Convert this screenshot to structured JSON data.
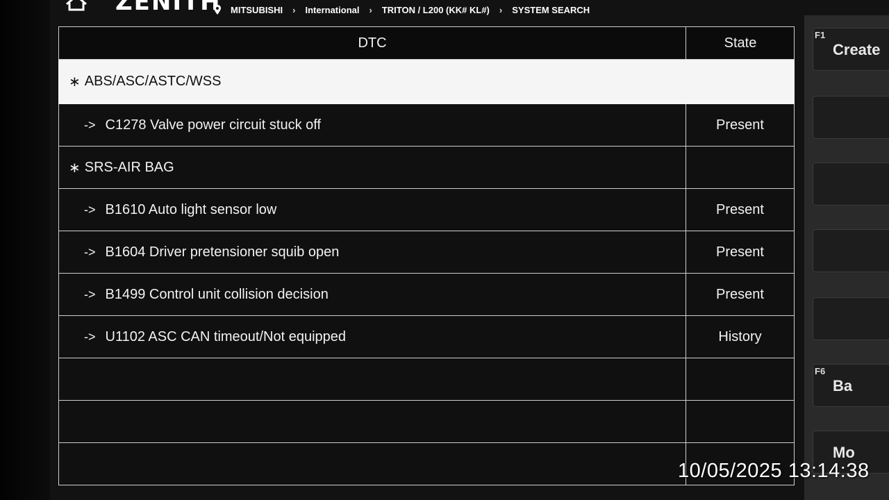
{
  "header": {
    "logo": "ZENITH",
    "breadcrumb": [
      "MITSUBISHI",
      "International",
      "TRITON / L200 (KK# KL#)",
      "SYSTEM SEARCH"
    ]
  },
  "table": {
    "col_dtc": "DTC",
    "col_state": "State",
    "rows": [
      {
        "kind": "group",
        "marker": "∗",
        "text": "ABS/ASC/ASTC/WSS",
        "state": "",
        "selected": true
      },
      {
        "kind": "code",
        "marker": "->",
        "text": "C1278 Valve power circuit stuck off",
        "state": "Present"
      },
      {
        "kind": "group",
        "marker": "∗",
        "text": "SRS-AIR BAG",
        "state": ""
      },
      {
        "kind": "code",
        "marker": "->",
        "text": "B1610 Auto light sensor low",
        "state": "Present"
      },
      {
        "kind": "code",
        "marker": "->",
        "text": "B1604 Driver pretensioner squib open",
        "state": "Present"
      },
      {
        "kind": "code",
        "marker": "->",
        "text": "B1499 Control unit collision decision",
        "state": "Present"
      },
      {
        "kind": "code",
        "marker": "->",
        "text": "U1102 ASC CAN timeout/Not equipped",
        "state": "History"
      },
      {
        "kind": "empty",
        "marker": "",
        "text": "",
        "state": ""
      },
      {
        "kind": "empty",
        "marker": "",
        "text": "",
        "state": ""
      },
      {
        "kind": "empty",
        "marker": "",
        "text": "",
        "state": ""
      }
    ]
  },
  "function_keys": [
    {
      "key": "F1",
      "label": "Create"
    },
    {
      "key": "",
      "label": ""
    },
    {
      "key": "",
      "label": ""
    },
    {
      "key": "",
      "label": ""
    },
    {
      "key": "",
      "label": ""
    },
    {
      "key": "F6",
      "label": "Ba"
    },
    {
      "key": "",
      "label": "Mo"
    }
  ],
  "overlay": {
    "timestamp": "10/05/2025 13:14:38"
  },
  "colors": {
    "background": "#121212",
    "selected_row": "#f5f5f5",
    "grid_line": "#cfcfcf"
  }
}
